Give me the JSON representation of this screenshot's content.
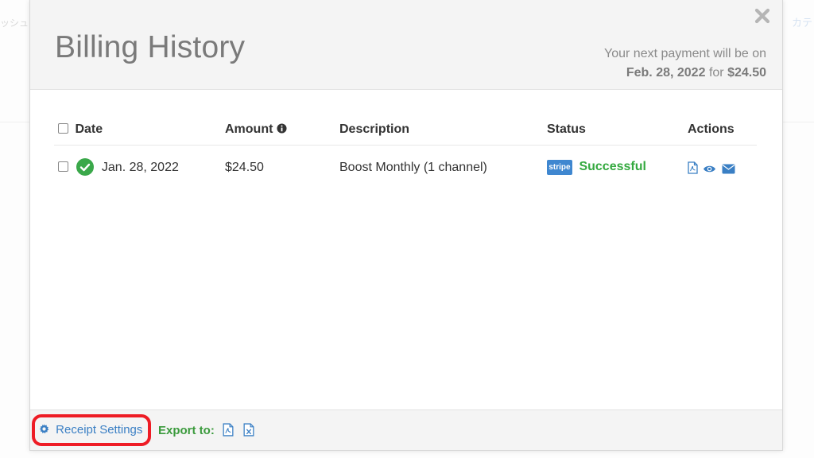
{
  "background": {
    "left_text": "ッシュ",
    "right_text": "カテ"
  },
  "modal": {
    "title": "Billing History",
    "next_payment": {
      "prefix": "Your next payment will be on",
      "date": "Feb. 28, 2022",
      "connector": "for",
      "amount": "$24.50"
    }
  },
  "table": {
    "headers": {
      "date": "Date",
      "amount": "Amount",
      "description": "Description",
      "status": "Status",
      "actions": "Actions"
    },
    "rows": [
      {
        "date": "Jan. 28, 2022",
        "amount": "$24.50",
        "description": "Boost Monthly (1 channel)",
        "payment_provider": "stripe",
        "status": "Successful"
      }
    ]
  },
  "footer": {
    "receipt_settings_label": "Receipt Settings",
    "export_label": "Export to:"
  },
  "colors": {
    "accent_blue": "#3a7fc4",
    "success_green": "#34a93f",
    "highlight_red": "#ee1c25"
  },
  "icons": {
    "close": "close-icon",
    "info": "info-icon",
    "check": "check-circle-icon",
    "pdf": "pdf-file-icon",
    "view": "eye-icon",
    "email": "envelope-icon",
    "settings": "gear-icon",
    "excel": "excel-file-icon"
  }
}
